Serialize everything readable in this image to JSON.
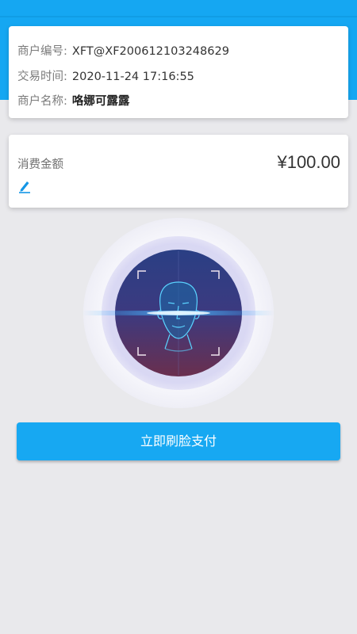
{
  "merchant_info": {
    "merchant_id_label": "商户编号:",
    "merchant_id_value": "XFT@XF200612103248629",
    "time_label": "交易时间:",
    "time_value": "2020-11-24 17:16:55",
    "merchant_name_label": "商户名称:",
    "merchant_name_value": "咯娜可露露"
  },
  "amount": {
    "label": "消费金额",
    "value": "¥100.00",
    "edit_icon": "pencil-icon"
  },
  "face_scan": {
    "icon": "face-recognition-icon"
  },
  "actions": {
    "pay_label": "立即刷脸支付"
  },
  "colors": {
    "accent": "#15a7f2",
    "background": "#e9e9ec"
  }
}
